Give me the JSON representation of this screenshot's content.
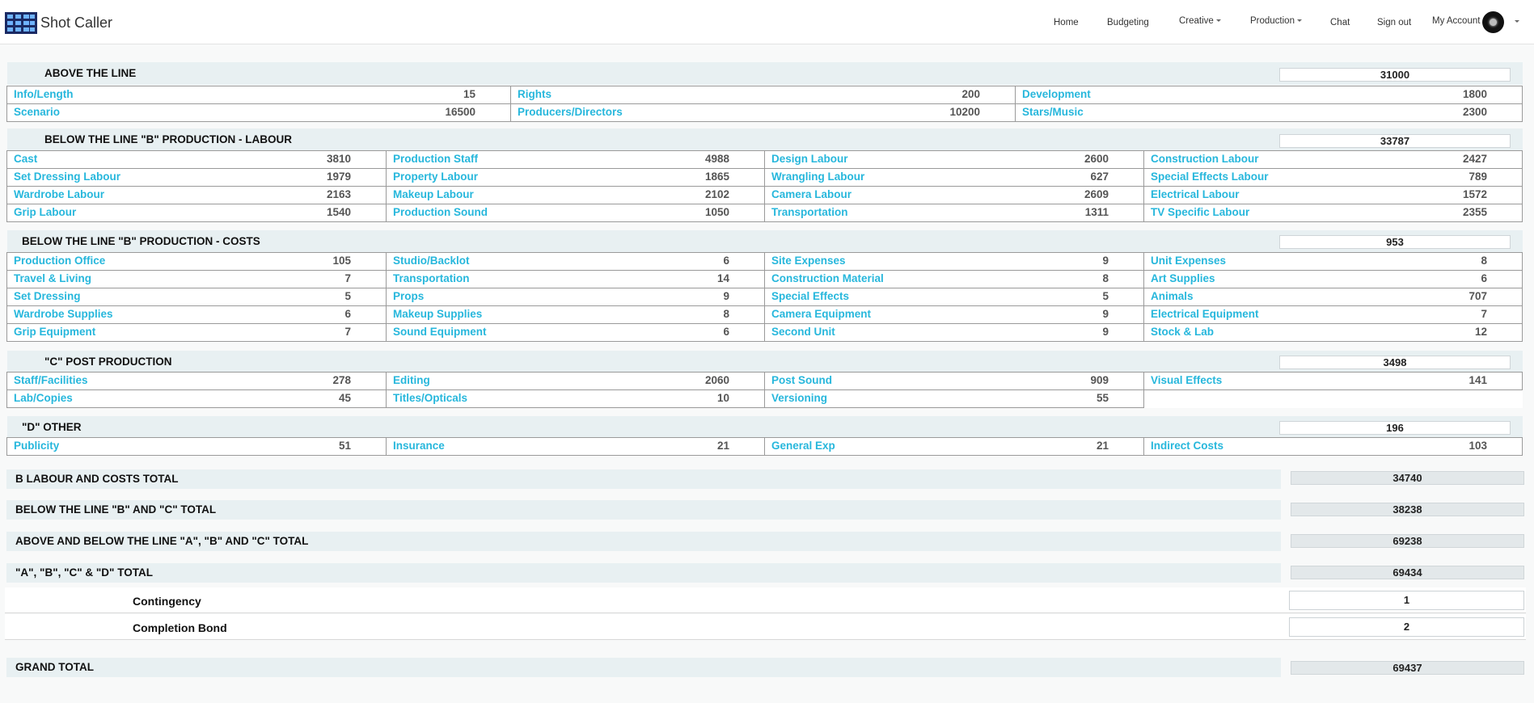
{
  "app": {
    "name": "Shot Caller",
    "nav": [
      {
        "label": "Home"
      },
      {
        "label": "Budgeting"
      },
      {
        "label": "Creative",
        "dropdown": true
      },
      {
        "label": "Production",
        "dropdown": true
      },
      {
        "label": "Chat"
      },
      {
        "label": "Sign out"
      },
      {
        "label": "My Account",
        "dropdown": true
      }
    ]
  },
  "sections": [
    {
      "title": "ABOVE THE LINE",
      "total": "31000",
      "items": [
        [
          {
            "label": "Info/Length",
            "value": "15"
          },
          {
            "label": "Rights",
            "value": "200"
          },
          {
            "label": "Development",
            "value": "1800"
          }
        ],
        [
          {
            "label": "Scenario",
            "value": "16500"
          },
          {
            "label": "Producers/Directors",
            "value": "10200"
          },
          {
            "label": "Stars/Music",
            "value": "2300"
          }
        ]
      ]
    },
    {
      "title": "BELOW THE LINE \"B\" PRODUCTION - LABOUR",
      "total": "33787",
      "items": [
        [
          {
            "label": "Cast",
            "value": "3810"
          },
          {
            "label": "Production Staff",
            "value": "4988"
          },
          {
            "label": "Design Labour",
            "value": "2600"
          },
          {
            "label": "Construction Labour",
            "value": "2427"
          }
        ],
        [
          {
            "label": "Set Dressing Labour",
            "value": "1979"
          },
          {
            "label": "Property Labour",
            "value": "1865"
          },
          {
            "label": "Wrangling Labour",
            "value": "627"
          },
          {
            "label": "Special Effects Labour",
            "value": "789"
          }
        ],
        [
          {
            "label": "Wardrobe Labour",
            "value": "2163"
          },
          {
            "label": "Makeup Labour",
            "value": "2102"
          },
          {
            "label": "Camera Labour",
            "value": "2609"
          },
          {
            "label": "Electrical Labour",
            "value": "1572"
          }
        ],
        [
          {
            "label": "Grip Labour",
            "value": "1540"
          },
          {
            "label": "Production Sound",
            "value": "1050"
          },
          {
            "label": "Transportation",
            "value": "1311"
          },
          {
            "label": "TV Specific Labour",
            "value": "2355"
          }
        ]
      ]
    },
    {
      "title": "BELOW THE LINE \"B\" PRODUCTION - COSTS",
      "total": "953",
      "items": [
        [
          {
            "label": "Production Office",
            "value": "105"
          },
          {
            "label": "Studio/Backlot",
            "value": "6"
          },
          {
            "label": "Site Expenses",
            "value": "9"
          },
          {
            "label": "Unit Expenses",
            "value": "8"
          }
        ],
        [
          {
            "label": "Travel & Living",
            "value": "7"
          },
          {
            "label": "Transportation",
            "value": "14"
          },
          {
            "label": "Construction Material",
            "value": "8"
          },
          {
            "label": "Art Supplies",
            "value": "6"
          }
        ],
        [
          {
            "label": "Set Dressing",
            "value": "5"
          },
          {
            "label": "Props",
            "value": "9"
          },
          {
            "label": "Special Effects",
            "value": "5"
          },
          {
            "label": "Animals",
            "value": "707"
          }
        ],
        [
          {
            "label": "Wardrobe Supplies",
            "value": "6"
          },
          {
            "label": "Makeup Supplies",
            "value": "8"
          },
          {
            "label": "Camera Equipment",
            "value": "9"
          },
          {
            "label": "Electrical Equipment",
            "value": "7"
          }
        ],
        [
          {
            "label": "Grip Equipment",
            "value": "7"
          },
          {
            "label": "Sound Equipment",
            "value": "6"
          },
          {
            "label": "Second Unit",
            "value": "9"
          },
          {
            "label": "Stock & Lab",
            "value": "12"
          }
        ]
      ]
    },
    {
      "title": "\"C\" POST PRODUCTION",
      "total": "3498",
      "items": [
        [
          {
            "label": "Staff/Facilities",
            "value": "278"
          },
          {
            "label": "Editing",
            "value": "2060"
          },
          {
            "label": "Post Sound",
            "value": "909"
          },
          {
            "label": "Visual Effects",
            "value": "141"
          }
        ],
        [
          {
            "label": "Lab/Copies",
            "value": "45"
          },
          {
            "label": "Titles/Opticals",
            "value": "10"
          },
          {
            "label": "Versioning",
            "value": "55"
          }
        ]
      ]
    },
    {
      "title": "\"D\" OTHER",
      "total": "196",
      "items": [
        [
          {
            "label": "Publicity",
            "value": "51"
          },
          {
            "label": "Insurance",
            "value": "21"
          },
          {
            "label": "General Exp",
            "value": "21"
          },
          {
            "label": "Indirect Costs",
            "value": "103"
          }
        ]
      ]
    }
  ],
  "totals": [
    {
      "label": "B LABOUR AND COSTS TOTAL",
      "value": "34740"
    },
    {
      "label": "BELOW THE LINE \"B\" AND \"C\" TOTAL",
      "value": "38238"
    },
    {
      "label": "ABOVE AND BELOW THE LINE \"A\", \"B\" AND \"C\" TOTAL",
      "value": "69238"
    },
    {
      "label": "\"A\", \"B\", \"C\" & \"D\" TOTAL",
      "value": "69434"
    }
  ],
  "extras": [
    {
      "label": "Contingency",
      "value": "1"
    },
    {
      "label": "Completion Bond",
      "value": "2"
    }
  ],
  "grand_total": {
    "label": "GRAND TOTAL",
    "value": "69437"
  },
  "colors": {
    "link": "#27b7dc",
    "header_bg": "#e8f0f2",
    "value_text": "#555555"
  }
}
